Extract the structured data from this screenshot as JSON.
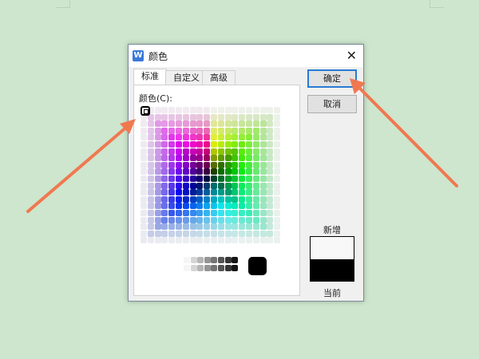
{
  "dialog": {
    "title": "颜色",
    "app_icon": "W",
    "close": "✕",
    "tabs": [
      {
        "label": "标准",
        "active": true
      },
      {
        "label": "自定义",
        "active": false
      },
      {
        "label": "高级",
        "active": false
      }
    ],
    "color_label": "颜色(C):",
    "ok_label": "确定",
    "cancel_label": "取消",
    "new_label": "新增",
    "current_label": "当前",
    "new_color": "#f8f8f8",
    "current_color": "#000000"
  },
  "annotation_color": "#f07850"
}
